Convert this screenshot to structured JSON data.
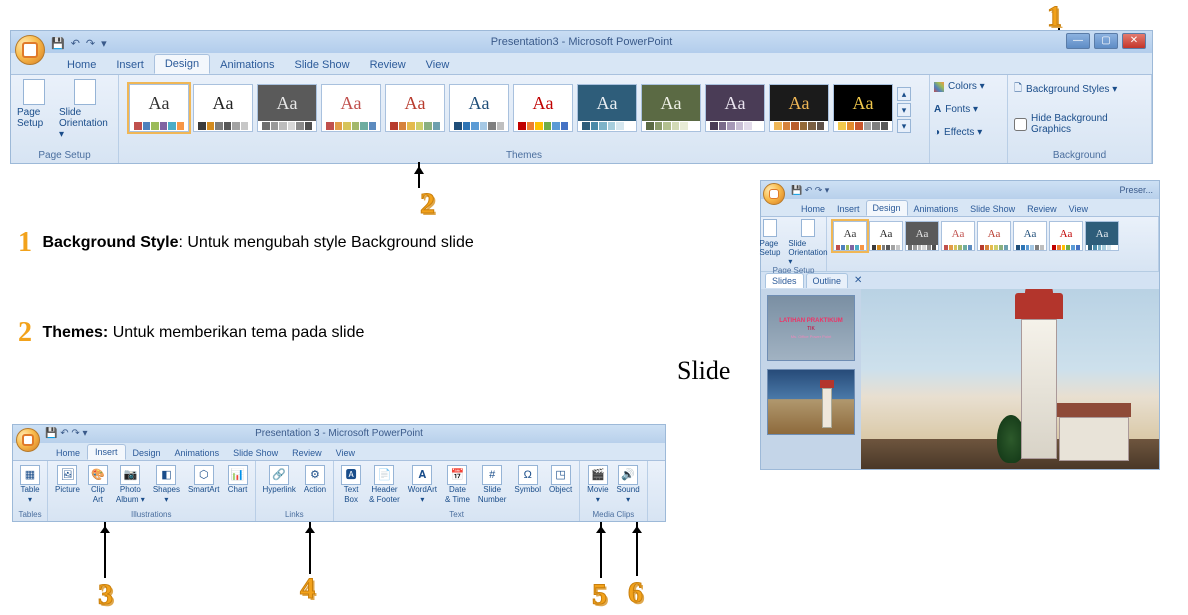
{
  "ribbon1": {
    "title": "Presentation3 - Microsoft PowerPoint",
    "tabs": [
      "Home",
      "Insert",
      "Design",
      "Animations",
      "Slide Show",
      "Review",
      "View"
    ],
    "active_tab": "Design",
    "page_setup": {
      "btn1": "Page Setup",
      "btn2": "Slide Orientation ▾",
      "label": "Page Setup"
    },
    "themes": {
      "label": "Themes",
      "items": [
        {
          "bg": "#ffffff",
          "fg": "#333333",
          "dots": [
            "#c0504d",
            "#4f81bd",
            "#9bbb59",
            "#8064a2",
            "#4bacc6",
            "#f79646"
          ]
        },
        {
          "bg": "#ffffff",
          "fg": "#222222",
          "dots": [
            "#3b3b3b",
            "#d38b1e",
            "#7b7b7b",
            "#575757",
            "#a3a3a3",
            "#c7c7c7"
          ]
        },
        {
          "bg": "#5a5a5a",
          "fg": "#e8e8e8",
          "dots": [
            "#6e6e6e",
            "#9a9a9a",
            "#bcbcbc",
            "#d7d7d7",
            "#8a8a8a",
            "#4f4f4f"
          ]
        },
        {
          "bg": "#ffffff",
          "fg": "#c0504d",
          "dots": [
            "#c0504d",
            "#e29c47",
            "#d7c45a",
            "#a3b86c",
            "#6eada0",
            "#5c8bbf"
          ]
        },
        {
          "bg": "#ffffff",
          "fg": "#b83b2d",
          "dots": [
            "#b83b2d",
            "#d6823b",
            "#e4bb4d",
            "#cfcf6a",
            "#8ab07f",
            "#6da0ae"
          ]
        },
        {
          "bg": "#ffffff",
          "fg": "#1f4e79",
          "dots": [
            "#1f4e79",
            "#2e75b6",
            "#5b9bd5",
            "#a5c8e4",
            "#7f7f7f",
            "#bfbfbf"
          ]
        },
        {
          "bg": "#ffffff",
          "fg": "#c00000",
          "dots": [
            "#c00000",
            "#ed7d31",
            "#ffc000",
            "#70ad47",
            "#5b9bd5",
            "#4472c4"
          ]
        },
        {
          "bg": "#2e5d7a",
          "fg": "#e8eef3",
          "dots": [
            "#2e5d7a",
            "#4a8aa8",
            "#7db3c8",
            "#a7cedd",
            "#d6e7ef",
            "#ffffff"
          ]
        },
        {
          "bg": "#5b6a44",
          "fg": "#eef0e6",
          "dots": [
            "#5b6a44",
            "#8a9a6a",
            "#b3c08f",
            "#d2dab6",
            "#e8ecd6",
            "#ffffff"
          ]
        },
        {
          "bg": "#4a3c56",
          "fg": "#e9e3ef",
          "dots": [
            "#4a3c56",
            "#7a6a8a",
            "#a698b6",
            "#c8bed4",
            "#e2dbea",
            "#ffffff"
          ]
        },
        {
          "bg": "#1b1b1b",
          "fg": "#f0b756",
          "dots": [
            "#f0b756",
            "#d6823b",
            "#b85d2d",
            "#946a38",
            "#7a5f42",
            "#5e5148"
          ]
        },
        {
          "bg": "#000000",
          "fg": "#f2c94c",
          "dots": [
            "#f2c94c",
            "#e28b2d",
            "#c9562d",
            "#a3a3a3",
            "#7f7f7f",
            "#595959"
          ]
        }
      ],
      "extra": {
        "colors": "Colors ▾",
        "fonts": "Fonts ▾",
        "effects": "Effects ▾"
      }
    },
    "background": {
      "styles": "Background Styles ▾",
      "hide": "Hide Background Graphics",
      "label": "Background"
    }
  },
  "explain": {
    "line1_bold": "Background Style",
    "line1_rest": ": Untuk mengubah style Background slide",
    "line2_bold": "Themes:",
    "line2_rest": " Untuk memberikan tema pada slide"
  },
  "callouts": {
    "n1": "1",
    "n2": "2",
    "n3": "3",
    "n4": "4",
    "n5": "5",
    "n6": "6"
  },
  "slide_label": "Slide",
  "win2": {
    "title": "Preser...",
    "tabs": [
      "Home",
      "Insert",
      "Design",
      "Animations",
      "Slide Show",
      "Review",
      "View"
    ],
    "active_tab": "Design",
    "page_setup": {
      "btn1": "Page Setup",
      "btn2": "Slide Orientation ▾",
      "label": "Page Setup"
    },
    "themes_label": "",
    "slides_tab": "Slides",
    "outline_tab": "Outline",
    "thumb1": {
      "t1": "LATIHAN PRAKTIKUM",
      "t2": "TIK",
      "t3": "Ms. Office Power Point"
    }
  },
  "win3": {
    "title": "Presentation 3 - Microsoft PowerPoint",
    "tabs": [
      "Home",
      "Insert",
      "Design",
      "Animations",
      "Slide Show",
      "Review",
      "View"
    ],
    "active_tab": "Insert",
    "groups": {
      "tables": {
        "label": "Tables",
        "items": [
          {
            "l1": "Table",
            "l2": "▾"
          }
        ]
      },
      "illustrations": {
        "label": "Illustrations",
        "items": [
          {
            "l1": "Picture"
          },
          {
            "l1": "Clip",
            "l2": "Art"
          },
          {
            "l1": "Photo",
            "l2": "Album ▾"
          },
          {
            "l1": "Shapes",
            "l2": "▾"
          },
          {
            "l1": "SmartArt"
          },
          {
            "l1": "Chart"
          }
        ]
      },
      "links": {
        "label": "Links",
        "items": [
          {
            "l1": "Hyperlink"
          },
          {
            "l1": "Action"
          }
        ]
      },
      "text": {
        "label": "Text",
        "items": [
          {
            "l1": "Text",
            "l2": "Box"
          },
          {
            "l1": "Header",
            "l2": "& Footer"
          },
          {
            "l1": "WordArt",
            "l2": "▾"
          },
          {
            "l1": "Date",
            "l2": "& Time"
          },
          {
            "l1": "Slide",
            "l2": "Number"
          },
          {
            "l1": "Symbol"
          },
          {
            "l1": "Object"
          }
        ]
      },
      "media": {
        "label": "Media Clips",
        "items": [
          {
            "l1": "Movie",
            "l2": "▾"
          },
          {
            "l1": "Sound",
            "l2": "▾"
          }
        ]
      }
    }
  }
}
